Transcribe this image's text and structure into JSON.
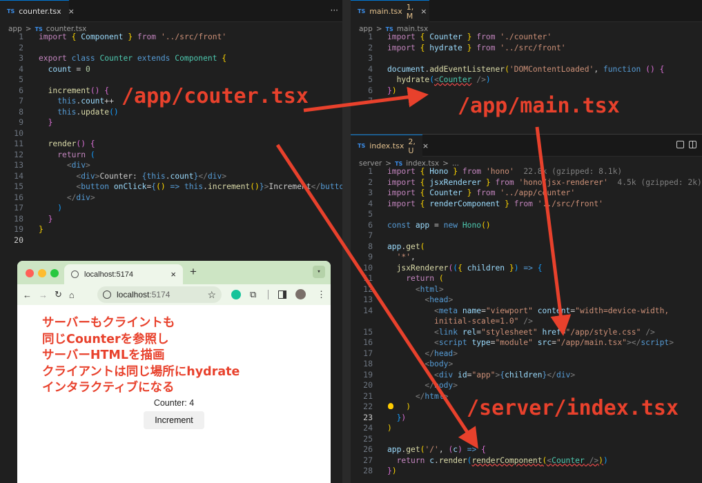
{
  "left_editor": {
    "tab": {
      "lang": "TS",
      "name": "counter.tsx",
      "close": "×"
    },
    "more": "···",
    "breadcrumb": {
      "folder": "app",
      "sep": ">",
      "lang": "TS",
      "file": "counter.tsx"
    },
    "line_numbers": [
      "1",
      "2",
      "3",
      "4",
      "5",
      "6",
      "7",
      "8",
      "9",
      "10",
      "11",
      "12",
      "13",
      "14",
      "15",
      "16",
      "17",
      "18",
      "19",
      "20"
    ]
  },
  "main_editor": {
    "tab": {
      "lang": "TS",
      "name": "main.tsx",
      "status": "1, M",
      "close": "×"
    },
    "breadcrumb": {
      "folder": "app",
      "sep": ">",
      "lang": "TS",
      "file": "main.tsx"
    },
    "line_numbers": [
      "1",
      "2",
      "3",
      "4",
      "5",
      "6",
      "7"
    ]
  },
  "index_editor": {
    "tab": {
      "lang": "TS",
      "name": "index.tsx",
      "status": "2, U",
      "close": "×"
    },
    "breadcrumb": {
      "folder": "server",
      "sep": ">",
      "lang": "TS",
      "file": "index.tsx",
      "more": "..."
    },
    "line_numbers": [
      "1",
      "2",
      "3",
      "4",
      "5",
      "6",
      "7",
      "8",
      "9",
      "10",
      "11",
      "12",
      "13",
      "14",
      "",
      "15",
      "16",
      "17",
      "18",
      "19",
      "20",
      "21",
      "22",
      "23",
      "24",
      "25",
      "26",
      "27",
      "28"
    ]
  },
  "overlay": {
    "counter_label": "/app/couter.tsx",
    "main_label": "/app/main.tsx",
    "server_label": "/server/index.tsx",
    "accent": "#e8412c"
  },
  "browser": {
    "tab_title": "localhost:5174",
    "tab_close": "×",
    "new_tab": "+",
    "url_host": "localhost",
    "url_port": ":5174",
    "notes": [
      "サーバーもクライントも",
      "同じCounterを参照し",
      "サーバーHTMLを描画",
      "クライアントは同じ場所にhydrate",
      "インタラクティブになる"
    ],
    "counter_text": "Counter: 4",
    "button_label": "Increment"
  }
}
